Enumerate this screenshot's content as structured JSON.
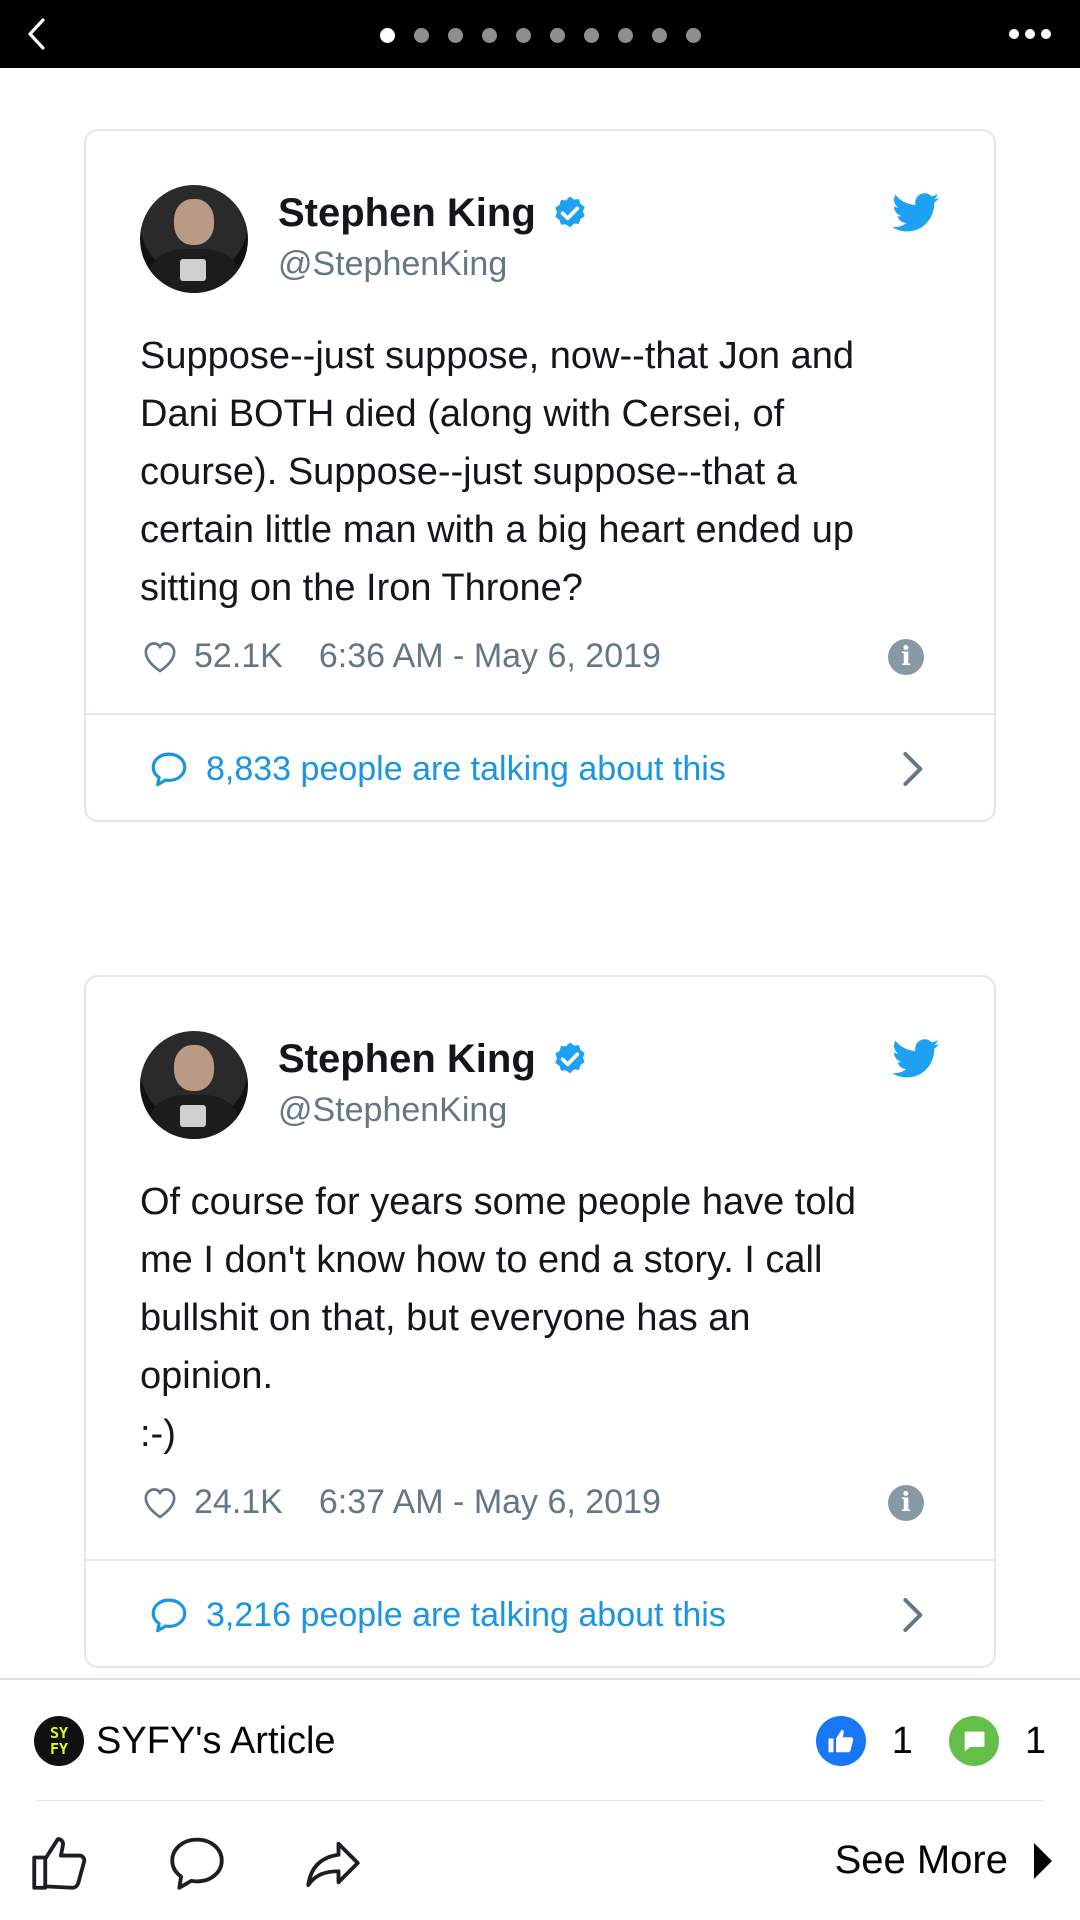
{
  "top_bar": {
    "pager_count": 10,
    "pager_active_index": 0
  },
  "tweets": [
    {
      "author": "Stephen King",
      "handle": "@StephenKing",
      "text": "Suppose--just suppose, now--that Jon and\nDani BOTH died (along with Cersei, of\ncourse). Suppose--just suppose--that a\ncertain little man with a big heart ended up\nsitting on the Iron Throne?",
      "likes": "52.1K",
      "timestamp": "6:36 AM - May 6, 2019",
      "talking": "8,833 people are talking about this"
    },
    {
      "author": "Stephen King",
      "handle": "@StephenKing",
      "text": "Of course for years some people have told\nme I don't know how to end a story. I call\nbullshit on that, but everyone has an\nopinion.\n:-)",
      "likes": "24.1K",
      "timestamp": "6:37 AM - May 6, 2019",
      "talking": "3,216 people are talking about this"
    }
  ],
  "bottom_bar": {
    "logo_text": "SY\nFY",
    "article_title": "SYFY's Article",
    "like_count": "1",
    "comment_count": "1",
    "see_more": "See More"
  },
  "colors": {
    "twitter_blue": "#1da1f2",
    "link_blue": "#1b95e0",
    "fb_blue": "#1877f2",
    "fb_green": "#63be4a"
  },
  "icons": [
    "back-chevron-icon",
    "more-icon",
    "verified-icon",
    "twitter-bird-icon",
    "heart-icon",
    "info-icon",
    "speech-bubble-icon",
    "chevron-right-icon",
    "thumbs-up-icon",
    "comment-icon",
    "share-icon",
    "caret-right-icon"
  ]
}
